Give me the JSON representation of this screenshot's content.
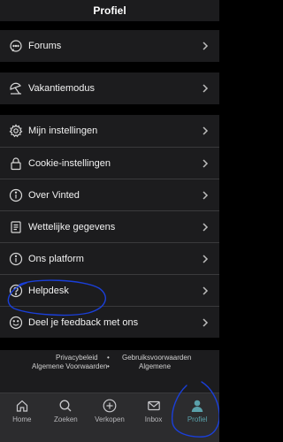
{
  "header": {
    "title": "Profiel"
  },
  "groups": [
    {
      "items": [
        {
          "icon": "chat-bubble-icon",
          "label": "Forums"
        }
      ]
    },
    {
      "items": [
        {
          "icon": "vacation-mode-icon",
          "label": "Vakantiemodus"
        }
      ]
    },
    {
      "items": [
        {
          "icon": "gear-icon",
          "label": "Mijn instellingen"
        },
        {
          "icon": "lock-icon",
          "label": "Cookie-instellingen"
        },
        {
          "icon": "info-icon",
          "label": "Over Vinted"
        },
        {
          "icon": "document-icon",
          "label": "Wettelijke gegevens"
        },
        {
          "icon": "info-icon",
          "label": "Ons platform"
        },
        {
          "icon": "help-icon",
          "label": "Helpdesk"
        },
        {
          "icon": "smiley-icon",
          "label": "Deel je feedback met ons"
        }
      ]
    }
  ],
  "footer": {
    "links": [
      "Privacybeleid",
      "Gebruiksvoorwaarden",
      "Algemene Voorwaarden",
      "Algemene"
    ],
    "separator": "•"
  },
  "tabbar": {
    "tabs": [
      {
        "icon": "home-icon",
        "label": "Home"
      },
      {
        "icon": "search-icon",
        "label": "Zoeken"
      },
      {
        "icon": "plus-circle-icon",
        "label": "Verkopen"
      },
      {
        "icon": "envelope-icon",
        "label": "Inbox"
      },
      {
        "icon": "person-icon",
        "label": "Profiel"
      }
    ],
    "active_index": 4
  },
  "colors": {
    "accent": "#5aa0aa",
    "annotation": "#1a3fd9",
    "background": "#000000",
    "surface": "#1c1c1e"
  }
}
